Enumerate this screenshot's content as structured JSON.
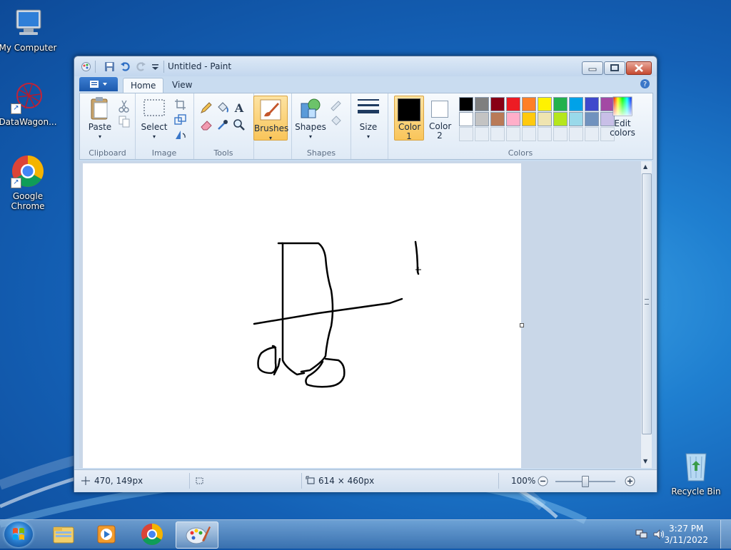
{
  "desktop": {
    "icons": [
      {
        "label": "My Computer"
      },
      {
        "label": "DataWagon..."
      },
      {
        "label": "Google Chrome"
      },
      {
        "label": "Recycle Bin"
      }
    ]
  },
  "window": {
    "title": "Untitled - Paint",
    "tabs": [
      {
        "label": "Home"
      },
      {
        "label": "View"
      }
    ],
    "ribbon": {
      "clipboard": {
        "label": "Clipboard",
        "paste": "Paste"
      },
      "image": {
        "label": "Image",
        "select": "Select"
      },
      "tools": {
        "label": "Tools"
      },
      "brushes": {
        "label": "Brushes"
      },
      "shapes": {
        "label": "Shapes",
        "shapes_btn": "Shapes"
      },
      "size": {
        "label": "Size"
      },
      "colors": {
        "label": "Colors",
        "color1": "Color 1",
        "color2": "Color 2",
        "edit": "Edit colors",
        "color1_value": "#000000",
        "color2_value": "#ffffff",
        "palette_row1": [
          "#000000",
          "#7f7f7f",
          "#880015",
          "#ed1c24",
          "#ff7f27",
          "#fff200",
          "#22b14c",
          "#00a2e8",
          "#3f48cc",
          "#a349a4"
        ],
        "palette_row2": [
          "#ffffff",
          "#c3c3c3",
          "#b97a57",
          "#ffaec9",
          "#ffc90e",
          "#efe4b0",
          "#b5e61d",
          "#99d9ea",
          "#7092be",
          "#c8bfe7"
        ]
      }
    },
    "status": {
      "cursor_pos": "470, 149px",
      "canvas_size": "614 × 460px",
      "zoom": "100%"
    }
  },
  "taskbar": {
    "time": "3:27 PM",
    "date": "3/11/2022"
  },
  "colors": {
    "accent": "#1c59ad",
    "brushes_active": "#f9c55a"
  }
}
